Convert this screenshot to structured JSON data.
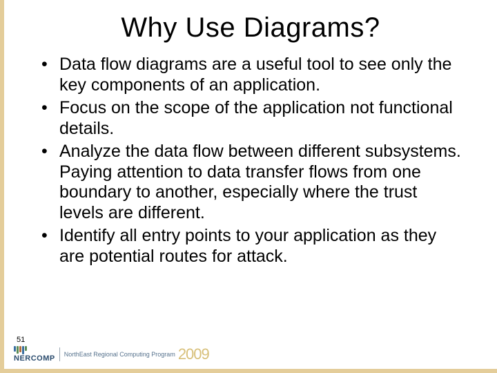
{
  "slide": {
    "title": "Why Use Diagrams?",
    "bullets": [
      "Data flow diagrams are a useful tool to see only the key components of an application.",
      "Focus on the scope of the application not functional details.",
      "Analyze the data flow between different subsystems. Paying attention to data transfer flows from one boundary to another, especially where the trust levels are different.",
      "Identify all entry points to your application as they are potential routes for attack."
    ],
    "page_number": "51",
    "footer": {
      "org_short": "NERCOMP",
      "org_long": "NorthEast Regional Computing Program",
      "year": "2009"
    }
  }
}
